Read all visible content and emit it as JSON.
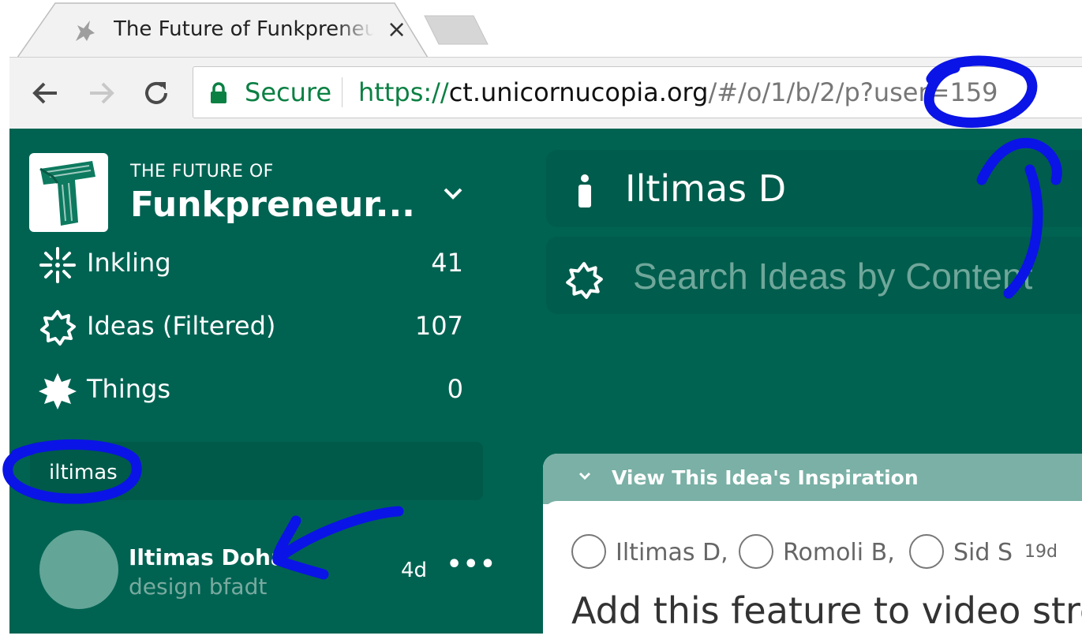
{
  "browser": {
    "tab_title": "The Future of Funkpreneur",
    "close_glyph": "×",
    "secure_label": "Secure",
    "url": {
      "protocol": "https://",
      "host": "ct.unicornucopia.org",
      "path": "/#/o/1/b/2/p?user=159"
    }
  },
  "sidebar": {
    "org_prefix": "THE FUTURE OF",
    "org_name": "Funkpreneur...",
    "items": [
      {
        "label": "Inkling",
        "count": "41",
        "icon": "inkling-burst-icon"
      },
      {
        "label": "Ideas (Filtered)",
        "count": "107",
        "icon": "idea-gear-icon"
      },
      {
        "label": "Things",
        "count": "0",
        "icon": "thing-star-icon"
      }
    ],
    "filter_value": "iltimas",
    "person": {
      "name": "Iltimas Doha",
      "subtitle": "design bfadt",
      "age": "4d",
      "more": "•••"
    }
  },
  "main": {
    "user_filter": "Iltimas D",
    "search_placeholder": "Search Ideas by Content",
    "idea": {
      "inspiration_label": "View This Idea's Inspiration",
      "participants": [
        "Iltimas D,",
        "Romoli B,",
        "Sid S"
      ],
      "age": "19d",
      "title": "Add this feature to video stre"
    }
  },
  "colors": {
    "app_bg": "#006352",
    "card_bg": "#005c4c",
    "inspiration_header": "#7ab0a5",
    "secure_green": "#0b8043",
    "annotation_blue": "#0a14e6"
  }
}
